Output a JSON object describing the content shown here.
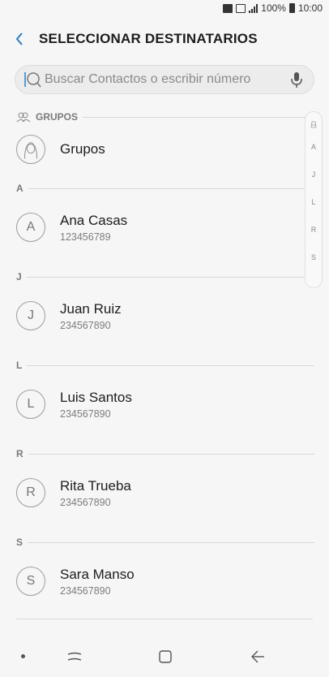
{
  "status_bar": {
    "battery_percent": "100%",
    "time": "10:00"
  },
  "header": {
    "title": "SELECCIONAR DESTINATARIOS"
  },
  "search": {
    "placeholder": "Buscar Contactos o escribir número"
  },
  "groups_section": {
    "label": "GRUPOS",
    "item_name": "Grupos"
  },
  "sections": [
    {
      "letter": "A",
      "contacts": [
        {
          "initial": "A",
          "name": "Ana Casas",
          "number": "123456789"
        }
      ]
    },
    {
      "letter": "J",
      "contacts": [
        {
          "initial": "J",
          "name": "Juan Ruiz",
          "number": "234567890"
        }
      ]
    },
    {
      "letter": "L",
      "contacts": [
        {
          "initial": "L",
          "name": "Luis Santos",
          "number": "234567890"
        }
      ]
    },
    {
      "letter": "R",
      "contacts": [
        {
          "initial": "R",
          "name": "Rita Trueba",
          "number": "234567890"
        }
      ]
    },
    {
      "letter": "S",
      "contacts": [
        {
          "initial": "S",
          "name": "Sara Manso",
          "number": "234567890"
        }
      ]
    }
  ],
  "index_scroller": [
    "A",
    "J",
    "L",
    "R",
    "S"
  ],
  "colors": {
    "accent": "#2d7fc4",
    "background": "#f6f6f6"
  },
  "icons": {
    "back": "chevron-left-icon",
    "search": "search-icon",
    "mic": "mic-icon",
    "groups": "groups-icon",
    "nav_recent": "recent-apps-icon",
    "nav_home": "home-icon",
    "nav_back": "back-arrow-icon"
  }
}
